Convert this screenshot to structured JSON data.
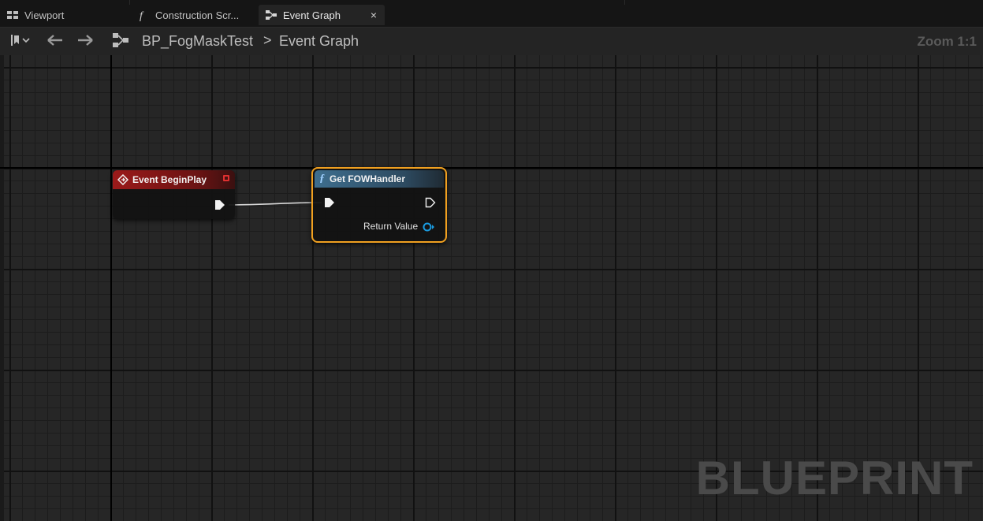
{
  "tabs": [
    {
      "label": "Viewport",
      "icon": "viewport-icon",
      "active": false
    },
    {
      "label": "Construction Scr...",
      "icon": "function-icon",
      "active": false
    },
    {
      "label": "Event Graph",
      "icon": "graph-icon",
      "active": true
    }
  ],
  "tab_close_glyph": "×",
  "toolbar": {
    "blueprint_name": "BP_FogMaskTest",
    "separator": ">",
    "graph_name": "Event Graph",
    "zoom": "Zoom 1:1"
  },
  "nodes": {
    "begin_play": {
      "title": "Event BeginPlay"
    },
    "get_fow": {
      "title": "Get FOWHandler",
      "return_label": "Return Value"
    }
  },
  "watermark": "BLUEPRINT",
  "colors": {
    "event_header": "#9b1a1a",
    "function_header": "#3e6e8e",
    "selection": "#f0a020",
    "object_pin": "#1a9be0"
  }
}
